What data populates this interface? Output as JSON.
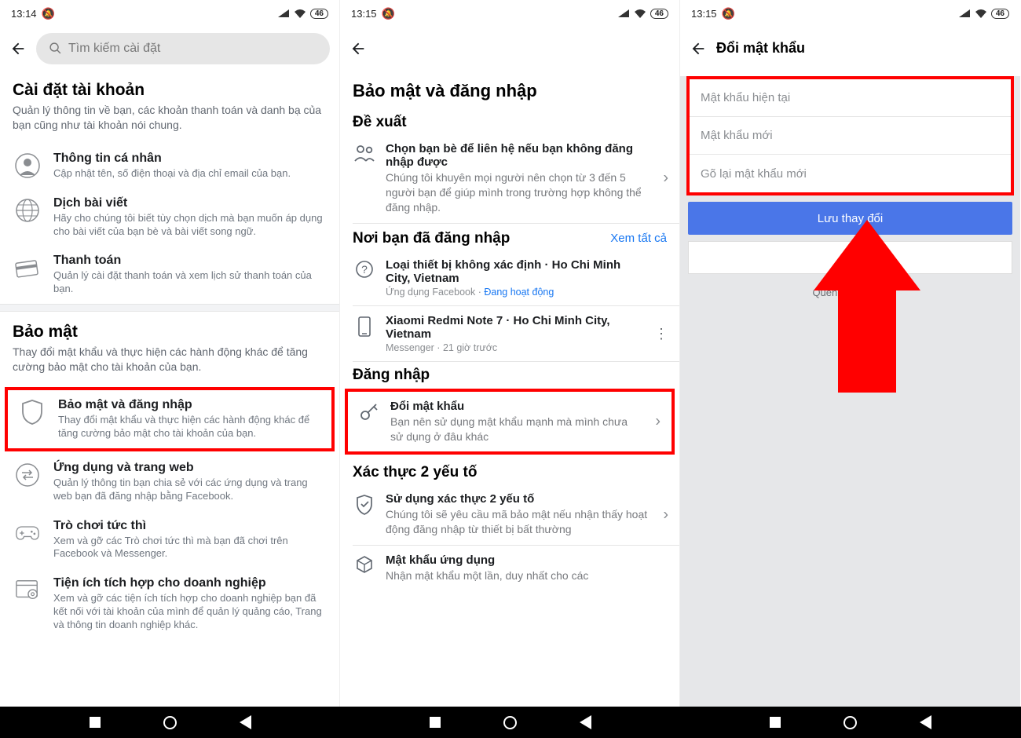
{
  "status": {
    "time1": "13:14",
    "time2": "13:15",
    "time3": "13:15",
    "battery": "46"
  },
  "screen1": {
    "search_placeholder": "Tìm kiếm cài đặt",
    "account_section": {
      "title": "Cài đặt tài khoản",
      "subtitle": "Quản lý thông tin về bạn, các khoản thanh toán và danh bạ của bạn cũng như tài khoản nói chung."
    },
    "items": [
      {
        "title": "Thông tin cá nhân",
        "desc": "Cập nhật tên, số điện thoại và địa chỉ email của bạn."
      },
      {
        "title": "Dịch bài viết",
        "desc": "Hãy cho chúng tôi biết tùy chọn dịch mà bạn muốn áp dụng cho bài viết của bạn bè và bài viết song ngữ."
      },
      {
        "title": "Thanh toán",
        "desc": "Quản lý cài đặt thanh toán và xem lịch sử thanh toán của bạn."
      }
    ],
    "security_section": {
      "title": "Bảo mật",
      "subtitle": "Thay đổi mật khẩu và thực hiện các hành động khác để tăng cường bảo mật cho tài khoản của bạn."
    },
    "sec_items": [
      {
        "title": "Bảo mật và đăng nhập",
        "desc": "Thay đổi mật khẩu và thực hiện các hành động khác để tăng cường bảo mật cho tài khoản của bạn."
      },
      {
        "title": "Ứng dụng và trang web",
        "desc": "Quản lý thông tin bạn chia sẻ với các ứng dụng và trang web bạn đã đăng nhập bằng Facebook."
      },
      {
        "title": "Trò chơi tức thì",
        "desc": "Xem và gỡ các Trò chơi tức thì mà bạn đã chơi trên Facebook và Messenger."
      },
      {
        "title": "Tiện ích tích hợp cho doanh nghiệp",
        "desc": "Xem và gỡ các tiện ích tích hợp cho doanh nghiệp bạn đã kết nối với tài khoản của mình để quản lý quảng cáo, Trang và thông tin doanh nghiệp khác."
      }
    ]
  },
  "screen2": {
    "page_title": "Bảo mật và đăng nhập",
    "sec1_title": "Đề xuất",
    "suggestion": {
      "title": "Chọn bạn bè để liên hệ nếu bạn không đăng nhập được",
      "desc": "Chúng tôi khuyên mọi người nên chọn từ 3 đến 5 người bạn để giúp mình trong trường hợp không thể đăng nhập."
    },
    "sec2_title": "Nơi bạn đã đăng nhập",
    "see_all": "Xem tất cả",
    "devices": [
      {
        "title": "Loại thiết bị không xác định · Ho Chi Minh City, Vietnam",
        "meta_app": "Ứng dụng Facebook · ",
        "meta_status": "Đang hoạt động"
      },
      {
        "title": "Xiaomi Redmi Note 7 · Ho Chi Minh City, Vietnam",
        "meta_full": "Messenger · 21 giờ trước"
      }
    ],
    "sec3_title": "Đăng nhập",
    "change_pw": {
      "title": "Đổi mật khẩu",
      "desc": "Bạn nên sử dụng mật khẩu mạnh mà mình chưa sử dụng ở đâu khác"
    },
    "sec4_title": "Xác thực 2 yếu tố",
    "twofa": {
      "title": "Sử dụng xác thực 2 yếu tố",
      "desc": "Chúng tôi sẽ yêu cầu mã bảo mật nếu nhận thấy hoạt động đăng nhập từ thiết bị bất thường"
    },
    "app_pw": {
      "title": "Mật khẩu ứng dụng",
      "desc": "Nhận mật khẩu một lần, duy nhất cho các"
    }
  },
  "screen3": {
    "header_title": "Đổi mật khẩu",
    "ph_current": "Mật khẩu hiện tại",
    "ph_new": "Mật khẩu mới",
    "ph_retype": "Gõ lại mật khẩu mới",
    "save": "Lưu thay đổi",
    "forgot": "Quên mật khẩu?"
  }
}
